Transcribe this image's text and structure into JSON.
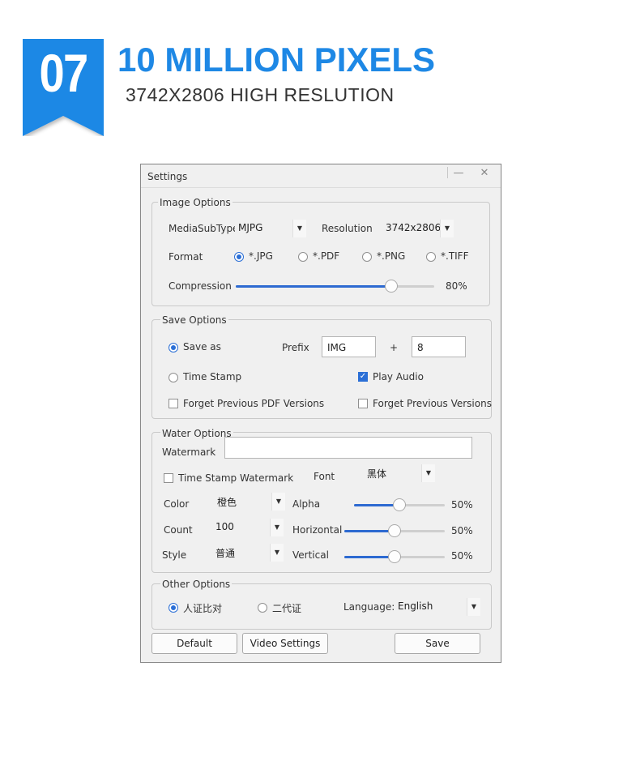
{
  "header": {
    "badge_number": "07",
    "title": "10 MILLION PIXELS",
    "subtitle": "3742X2806 HIGH RESLUTION",
    "accent_color": "#1e88e5"
  },
  "window": {
    "title": "Settings",
    "minimize_icon": "minimize-icon",
    "close_icon": "close-icon"
  },
  "image_options": {
    "title": "Image Options",
    "media_label": "MediaSubTypе",
    "media_value": "MJPG",
    "resolution_label": "Resolution",
    "resolution_value": "3742x2806",
    "format_label": "Format",
    "formats": [
      "*.JPG",
      "*.PDF",
      "*.PNG",
      "*.TIFF"
    ],
    "selected_format": "*.JPG",
    "compression_label": "Compression",
    "compression_value": "80%",
    "compression_level": 0.8
  },
  "save_options": {
    "title": "Save Options",
    "save_as_label": "Save as",
    "prefix_label": "Prefix",
    "prefix_value": "IMG",
    "plus": "+",
    "number_value": "8",
    "timestamp_label": "Time Stamp",
    "play_audio_label": "Play Audio",
    "play_audio_checked": true,
    "forget_pdf_label": "Forget Previous PDF Versions",
    "forget_versions_label": "Forget Previous Versions"
  },
  "water_options": {
    "title": "Water Options",
    "watermark_label": "Watermark",
    "watermark_value": "",
    "timestamp_watermark_label": "Time Stamp Watermark",
    "font_label": "Font",
    "font_value": "黑体",
    "color_label": "Color",
    "color_value": "橙色",
    "count_label": "Count",
    "count_value": "100",
    "style_label": "Style",
    "style_value": "普通",
    "alpha_label": "Alpha",
    "alpha_value": "50%",
    "horizontal_label": "Horizontal",
    "horizontal_value": "50%",
    "vertical_label": "Vertical",
    "vertical_value": "50%"
  },
  "other_options": {
    "title": "Other Options",
    "radio1_label": "人证比对",
    "radio2_label": "二代证",
    "language_label": "Language:",
    "language_value": "English"
  },
  "buttons": {
    "default_label": "Default",
    "video_settings_label": "Video Settings",
    "save_label": "Save"
  }
}
